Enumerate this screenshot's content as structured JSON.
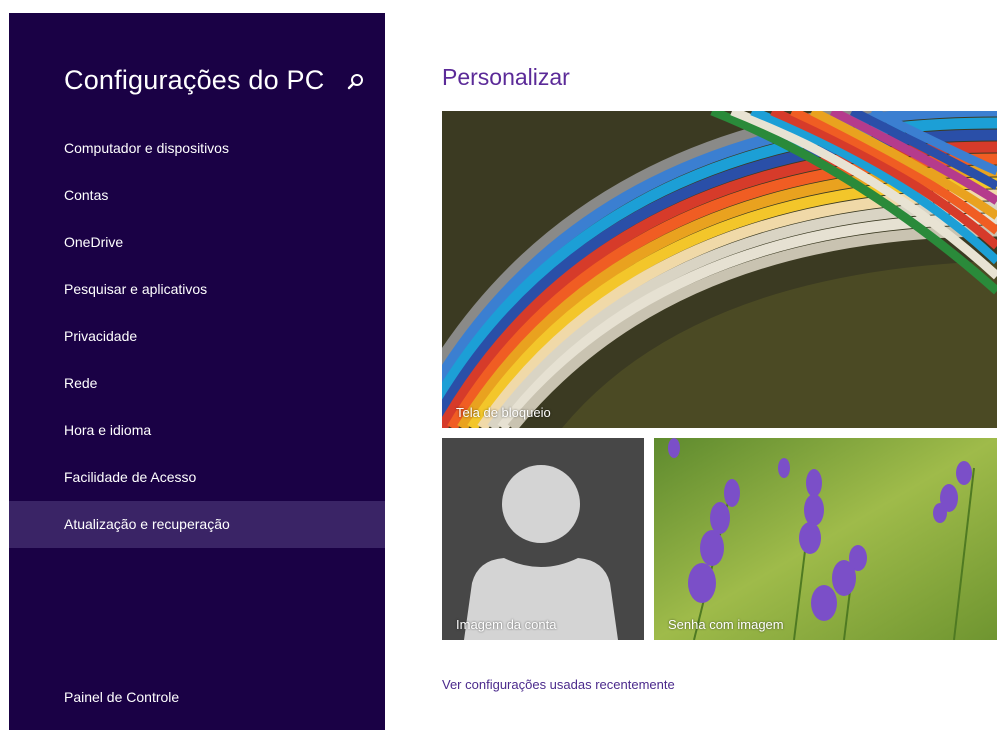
{
  "sidebar": {
    "title": "Configurações do PC",
    "search_icon": "search-icon",
    "items": [
      {
        "label": "Computador e dispositivos"
      },
      {
        "label": "Contas"
      },
      {
        "label": "OneDrive"
      },
      {
        "label": "Pesquisar e aplicativos"
      },
      {
        "label": "Privacidade"
      },
      {
        "label": "Rede"
      },
      {
        "label": "Hora e idioma"
      },
      {
        "label": "Facilidade de Acesso"
      },
      {
        "label": "Atualização e recuperação",
        "selected": true
      }
    ],
    "footer_link": "Painel de Controle"
  },
  "main": {
    "title": "Personalizar",
    "tiles": {
      "lock_screen": "Tela de bloqueio",
      "account_picture": "Imagem da conta",
      "picture_password": "Senha com imagem"
    },
    "recent_link": "Ver configurações usadas recentemente"
  },
  "colors": {
    "sidebar_bg": "#1a0145",
    "selected_bg": "#3a2466",
    "accent": "#5b2a98"
  }
}
